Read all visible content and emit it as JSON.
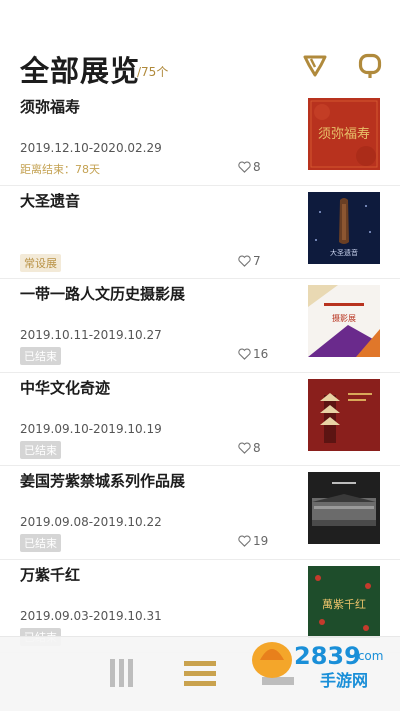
{
  "header": {
    "title": "全部展览",
    "count": "/75个",
    "filter_icon": "filter-icon",
    "search_icon": "search-icon"
  },
  "colors": {
    "accent": "#b08a3c",
    "status_remaining": "#c4a253",
    "status_ended_bg": "#d5d5d5"
  },
  "exhibitions": [
    {
      "title": "须弥福寿",
      "date": "2019.12.10-2020.02.29",
      "status": "距离结束：78天",
      "status_type": "remaining",
      "likes": "8",
      "thumb_text": "须弥福寿"
    },
    {
      "title": "大圣遗音",
      "date": "",
      "status": "常设展",
      "status_type": "permanent",
      "likes": "7",
      "thumb_text": "大圣遗音"
    },
    {
      "title": "一带一路人文历史摄影展",
      "date": "2019.10.11-2019.10.27",
      "status": "已结束",
      "status_type": "ended",
      "likes": "16",
      "thumb_text": "摄影展"
    },
    {
      "title": "中华文化奇迹",
      "date": "2019.09.10-2019.10.19",
      "status": "已结束",
      "status_type": "ended",
      "likes": "8",
      "thumb_text": ""
    },
    {
      "title": "姜国芳紫禁城系列作品展",
      "date": "2019.09.08-2019.10.22",
      "status": "已结束",
      "status_type": "ended",
      "likes": "19",
      "thumb_text": ""
    },
    {
      "title": "万紫千红",
      "date": "2019.09.03-2019.10.31",
      "status": "已结束",
      "status_type": "ended",
      "likes": "",
      "thumb_text": "萬紫千红"
    }
  ],
  "tabbar": {
    "tabs": [
      {
        "icon": "columns-icon"
      },
      {
        "icon": "list-icon"
      },
      {
        "icon": "collection-icon"
      }
    ]
  },
  "watermark": {
    "brand": "2839",
    "sub": "手游网",
    "suffix": ".com"
  }
}
